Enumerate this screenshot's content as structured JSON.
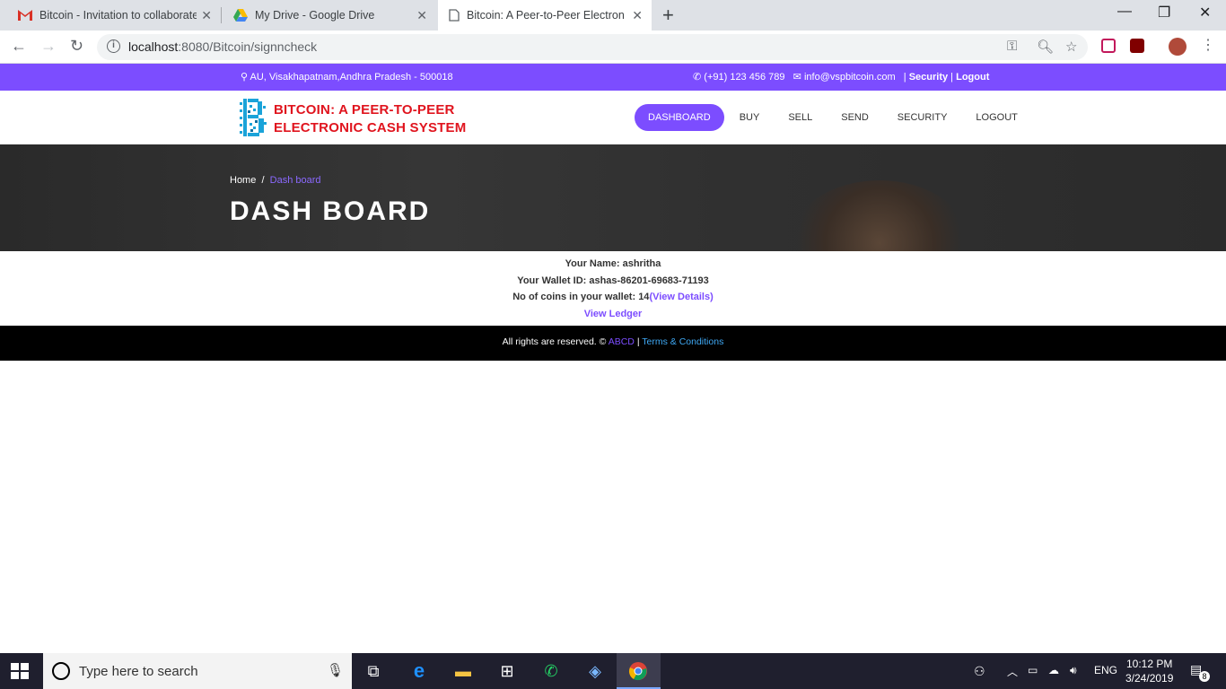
{
  "browser": {
    "tabs": [
      {
        "title": "Bitcoin - Invitation to collaborate",
        "icon": "gmail-icon"
      },
      {
        "title": "My Drive - Google Drive",
        "icon": "drive-icon"
      },
      {
        "title": "Bitcoin: A Peer-to-Peer Electronic",
        "icon": "page-icon",
        "active": true
      }
    ],
    "url_host": "localhost",
    "url_path": ":8080/Bitcoin/signncheck"
  },
  "topbar": {
    "address": "AU, Visakhapatnam,Andhra Pradesh - 500018",
    "phone": "(+91) 123 456 789",
    "email": "info@vspbitcoin.com",
    "security_link": "Security",
    "logout_link": "Logout"
  },
  "header": {
    "logo_line1": "BITCOIN: A PEER-TO-PEER",
    "logo_line2": "ELECTRONIC CASH SYSTEM",
    "nav": [
      "DASHBOARD",
      "BUY",
      "SELL",
      "SEND",
      "SECURITY",
      "LOGOUT"
    ]
  },
  "hero": {
    "breadcrumb_home": "Home",
    "breadcrumb_sep": "/",
    "breadcrumb_current": "Dash board",
    "title": "DASH BOARD"
  },
  "info": {
    "name_label": "Your Name: ashritha",
    "wallet_label": "Your Wallet ID: ashas-86201-69683-71193",
    "coins_label": "No of coins in your wallet: 14",
    "view_details": "(View Details)",
    "view_ledger": "View Ledger"
  },
  "footer": {
    "rights": "All rights are reserved. ©",
    "abcd": "ABCD",
    "sep": "|",
    "terms": "Terms & Conditions"
  },
  "taskbar": {
    "search_placeholder": "Type here to search",
    "language": "ENG",
    "time": "10:12 PM",
    "date": "3/24/2019",
    "notification_count": "8"
  },
  "colors": {
    "accent": "#7c4dff",
    "logo_red": "#e0141e",
    "footer_link": "#3fa9f5"
  }
}
